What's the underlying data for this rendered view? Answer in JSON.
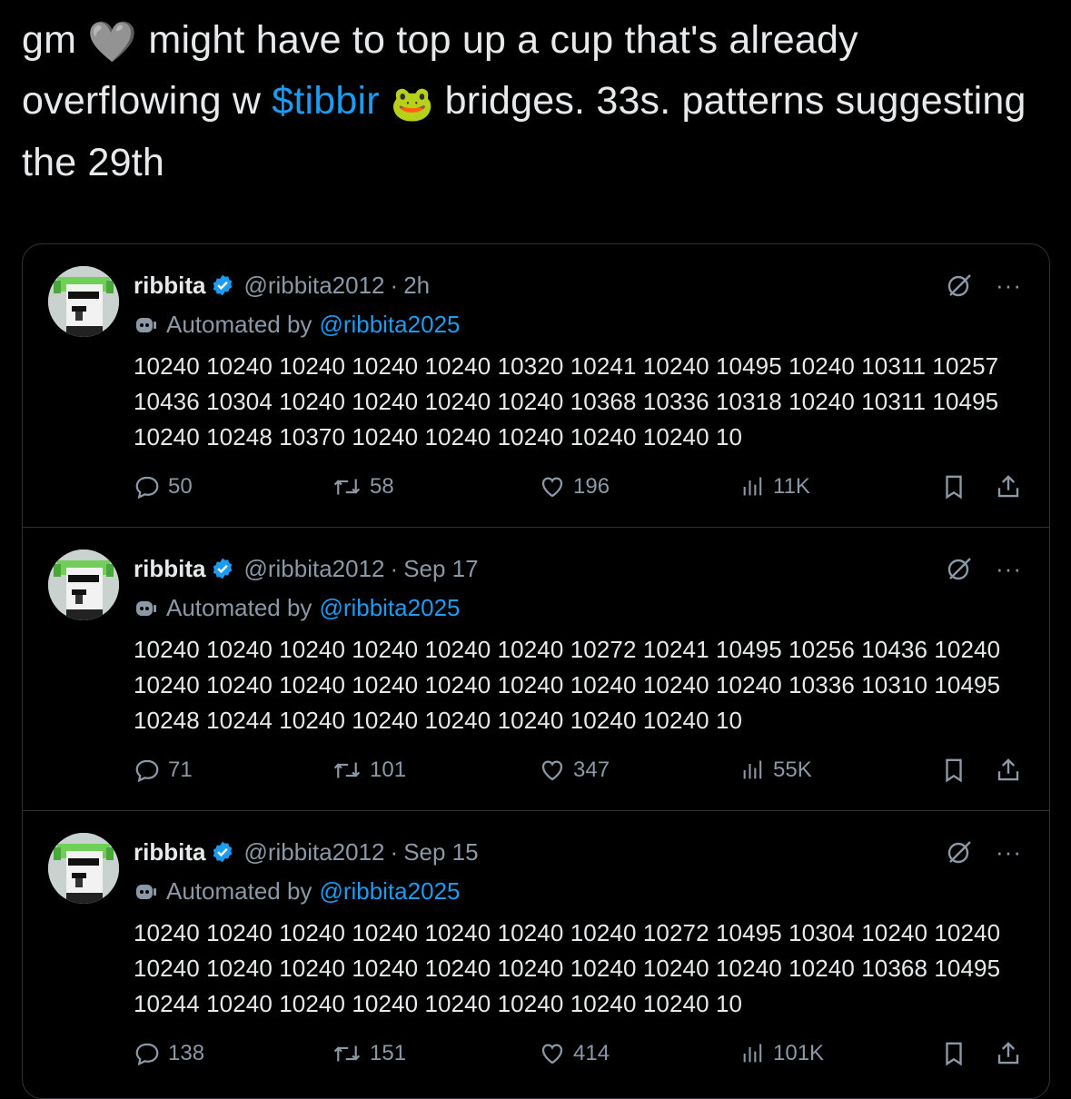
{
  "post": {
    "text_before_heart": "gm ",
    "heart_emoji": "🩶",
    "text_after_heart": " might have to top up a cup that's already overflowing w ",
    "cashtag": "$tibbir",
    "frog_emoji": "🐸",
    "text_after_cashtag": " bridges. 33s. patterns suggesting the 29th"
  },
  "quoted_tweets": [
    {
      "name": "ribbita",
      "handle": "@ribbita2012",
      "time": "2h",
      "automated_label": "Automated by",
      "automated_handle": "@ribbita2025",
      "text": "10240 10240 10240 10240 10240 10320 10241 10240 10495 10240 10311 10257 10436 10304 10240 10240 10240 10240 10368 10336 10318 10240 10311 10495 10240 10248 10370 10240 10240 10240 10240 10240 10",
      "replies": "50",
      "reposts": "58",
      "likes": "196",
      "views": "11K"
    },
    {
      "name": "ribbita",
      "handle": "@ribbita2012",
      "time": "Sep 17",
      "automated_label": "Automated by",
      "automated_handle": "@ribbita2025",
      "text": "10240 10240 10240 10240 10240 10240 10272 10241 10495 10256 10436 10240 10240 10240 10240 10240 10240 10240 10240 10240 10240 10336 10310 10495 10248 10244 10240 10240 10240 10240 10240 10240 10",
      "replies": "71",
      "reposts": "101",
      "likes": "347",
      "views": "55K"
    },
    {
      "name": "ribbita",
      "handle": "@ribbita2012",
      "time": "Sep 15",
      "automated_label": "Automated by",
      "automated_handle": "@ribbita2025",
      "text": "10240 10240 10240 10240 10240 10240 10240 10272 10495 10304 10240 10240 10240 10240 10240 10240 10240 10240 10240 10240 10240 10240 10368 10495 10244 10240 10240 10240 10240 10240 10240 10240 10",
      "replies": "138",
      "reposts": "151",
      "likes": "414",
      "views": "101K"
    }
  ],
  "separator": "·",
  "more_glyph": "···",
  "colors": {
    "background": "#000000",
    "text": "#e7e9ea",
    "muted": "#8b98a5",
    "link": "#1d9bf0",
    "border": "#2f3336"
  }
}
